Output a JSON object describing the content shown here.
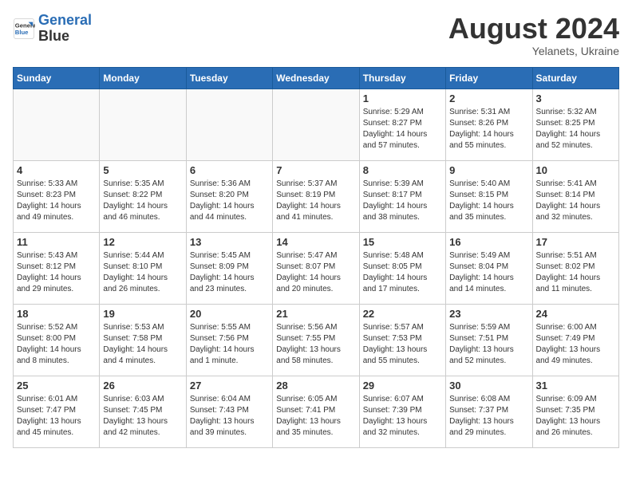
{
  "header": {
    "logo_line1": "General",
    "logo_line2": "Blue",
    "month_year": "August 2024",
    "location": "Yelanets, Ukraine"
  },
  "days_of_week": [
    "Sunday",
    "Monday",
    "Tuesday",
    "Wednesday",
    "Thursday",
    "Friday",
    "Saturday"
  ],
  "weeks": [
    [
      {
        "day": "",
        "info": ""
      },
      {
        "day": "",
        "info": ""
      },
      {
        "day": "",
        "info": ""
      },
      {
        "day": "",
        "info": ""
      },
      {
        "day": "1",
        "info": "Sunrise: 5:29 AM\nSunset: 8:27 PM\nDaylight: 14 hours\nand 57 minutes."
      },
      {
        "day": "2",
        "info": "Sunrise: 5:31 AM\nSunset: 8:26 PM\nDaylight: 14 hours\nand 55 minutes."
      },
      {
        "day": "3",
        "info": "Sunrise: 5:32 AM\nSunset: 8:25 PM\nDaylight: 14 hours\nand 52 minutes."
      }
    ],
    [
      {
        "day": "4",
        "info": "Sunrise: 5:33 AM\nSunset: 8:23 PM\nDaylight: 14 hours\nand 49 minutes."
      },
      {
        "day": "5",
        "info": "Sunrise: 5:35 AM\nSunset: 8:22 PM\nDaylight: 14 hours\nand 46 minutes."
      },
      {
        "day": "6",
        "info": "Sunrise: 5:36 AM\nSunset: 8:20 PM\nDaylight: 14 hours\nand 44 minutes."
      },
      {
        "day": "7",
        "info": "Sunrise: 5:37 AM\nSunset: 8:19 PM\nDaylight: 14 hours\nand 41 minutes."
      },
      {
        "day": "8",
        "info": "Sunrise: 5:39 AM\nSunset: 8:17 PM\nDaylight: 14 hours\nand 38 minutes."
      },
      {
        "day": "9",
        "info": "Sunrise: 5:40 AM\nSunset: 8:15 PM\nDaylight: 14 hours\nand 35 minutes."
      },
      {
        "day": "10",
        "info": "Sunrise: 5:41 AM\nSunset: 8:14 PM\nDaylight: 14 hours\nand 32 minutes."
      }
    ],
    [
      {
        "day": "11",
        "info": "Sunrise: 5:43 AM\nSunset: 8:12 PM\nDaylight: 14 hours\nand 29 minutes."
      },
      {
        "day": "12",
        "info": "Sunrise: 5:44 AM\nSunset: 8:10 PM\nDaylight: 14 hours\nand 26 minutes."
      },
      {
        "day": "13",
        "info": "Sunrise: 5:45 AM\nSunset: 8:09 PM\nDaylight: 14 hours\nand 23 minutes."
      },
      {
        "day": "14",
        "info": "Sunrise: 5:47 AM\nSunset: 8:07 PM\nDaylight: 14 hours\nand 20 minutes."
      },
      {
        "day": "15",
        "info": "Sunrise: 5:48 AM\nSunset: 8:05 PM\nDaylight: 14 hours\nand 17 minutes."
      },
      {
        "day": "16",
        "info": "Sunrise: 5:49 AM\nSunset: 8:04 PM\nDaylight: 14 hours\nand 14 minutes."
      },
      {
        "day": "17",
        "info": "Sunrise: 5:51 AM\nSunset: 8:02 PM\nDaylight: 14 hours\nand 11 minutes."
      }
    ],
    [
      {
        "day": "18",
        "info": "Sunrise: 5:52 AM\nSunset: 8:00 PM\nDaylight: 14 hours\nand 8 minutes."
      },
      {
        "day": "19",
        "info": "Sunrise: 5:53 AM\nSunset: 7:58 PM\nDaylight: 14 hours\nand 4 minutes."
      },
      {
        "day": "20",
        "info": "Sunrise: 5:55 AM\nSunset: 7:56 PM\nDaylight: 14 hours\nand 1 minute."
      },
      {
        "day": "21",
        "info": "Sunrise: 5:56 AM\nSunset: 7:55 PM\nDaylight: 13 hours\nand 58 minutes."
      },
      {
        "day": "22",
        "info": "Sunrise: 5:57 AM\nSunset: 7:53 PM\nDaylight: 13 hours\nand 55 minutes."
      },
      {
        "day": "23",
        "info": "Sunrise: 5:59 AM\nSunset: 7:51 PM\nDaylight: 13 hours\nand 52 minutes."
      },
      {
        "day": "24",
        "info": "Sunrise: 6:00 AM\nSunset: 7:49 PM\nDaylight: 13 hours\nand 49 minutes."
      }
    ],
    [
      {
        "day": "25",
        "info": "Sunrise: 6:01 AM\nSunset: 7:47 PM\nDaylight: 13 hours\nand 45 minutes."
      },
      {
        "day": "26",
        "info": "Sunrise: 6:03 AM\nSunset: 7:45 PM\nDaylight: 13 hours\nand 42 minutes."
      },
      {
        "day": "27",
        "info": "Sunrise: 6:04 AM\nSunset: 7:43 PM\nDaylight: 13 hours\nand 39 minutes."
      },
      {
        "day": "28",
        "info": "Sunrise: 6:05 AM\nSunset: 7:41 PM\nDaylight: 13 hours\nand 35 minutes."
      },
      {
        "day": "29",
        "info": "Sunrise: 6:07 AM\nSunset: 7:39 PM\nDaylight: 13 hours\nand 32 minutes."
      },
      {
        "day": "30",
        "info": "Sunrise: 6:08 AM\nSunset: 7:37 PM\nDaylight: 13 hours\nand 29 minutes."
      },
      {
        "day": "31",
        "info": "Sunrise: 6:09 AM\nSunset: 7:35 PM\nDaylight: 13 hours\nand 26 minutes."
      }
    ]
  ]
}
